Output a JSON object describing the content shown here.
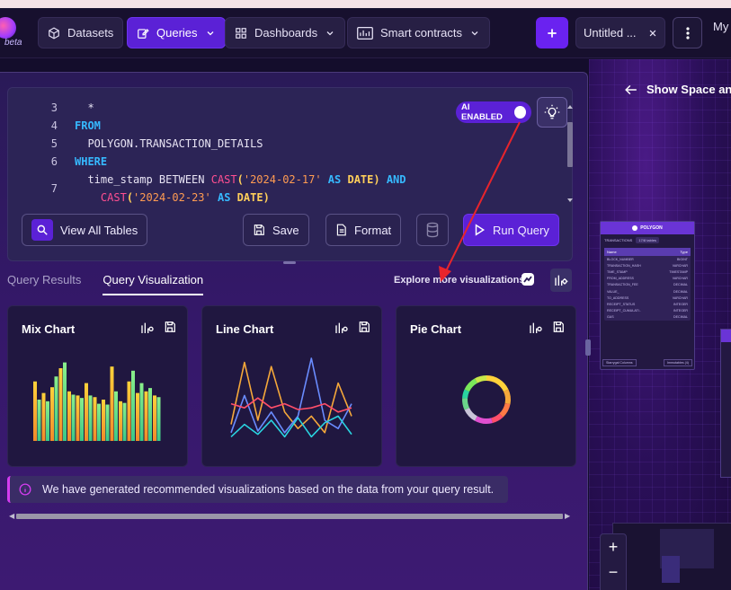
{
  "colors": {
    "accent": "#5b21d6",
    "panel": "#2c2456",
    "keyword": "#36b9ff",
    "function": "#ff4f91",
    "string": "#ff9b52",
    "type": "#ffcf5a",
    "arrow": "#e8242c"
  },
  "brand": {
    "logo_icon": "gradient-orb-icon",
    "badge": "beta"
  },
  "nav": {
    "datasets": "Datasets",
    "queries": "Queries",
    "dashboards": "Dashboards",
    "smart_contracts": "Smart contracts",
    "tab_title": "Untitled ...",
    "my_label": "My"
  },
  "editor": {
    "lines": [
      {
        "n": "3",
        "text": "  *"
      },
      {
        "n": "4",
        "text": "FROM"
      },
      {
        "n": "5",
        "text": "  POLYGON.TRANSACTION_DETAILS"
      },
      {
        "n": "6",
        "text": "WHERE"
      },
      {
        "n": "7",
        "text": "  time_stamp BETWEEN CAST('2024-02-17' AS DATE) AND"
      },
      {
        "n": "",
        "text": "    CAST('2024-02-23' AS DATE)"
      }
    ],
    "code": {
      "l3": "  *",
      "l4_kw": "FROM",
      "l5": "  POLYGON.TRANSACTION_DETAILS",
      "l6_kw": "WHERE",
      "l7_a": "  time_stamp BETWEEN ",
      "cast": "CAST",
      "paren_open": "(",
      "date1": "'2024-02-17'",
      "as": " AS ",
      "date_type": "DATE",
      "paren_close_and": ") ",
      "and": "AND",
      "l8_indent": "    ",
      "date2": "'2024-02-23'",
      "paren_close": ")"
    },
    "ai_label": "AI ENABLED",
    "buttons": {
      "view_all_tables": "View All Tables",
      "save": "Save",
      "format": "Format",
      "run_query": "Run Query"
    }
  },
  "results": {
    "tabs": [
      "Query Results",
      "Query Visualization"
    ],
    "active_tab": "Query Visualization",
    "explore": "Explore more visualizations",
    "cards": [
      {
        "title": "Mix Chart"
      },
      {
        "title": "Line Chart"
      },
      {
        "title": "Pie Chart"
      }
    ],
    "info": "We have generated recommended visualizations based on the data from your query result."
  },
  "canvas": {
    "back_label": "Show Space and",
    "node_title": "POLYGON",
    "node_tab": "TRANSACTIONS",
    "node_badge": "17/8 tables",
    "columns_header": [
      "Name",
      "Type"
    ],
    "columns": [
      [
        "BLOCK_NUMBER",
        "BIGINT"
      ],
      [
        "TRANSACTION_HASH",
        "VARCHAR"
      ],
      [
        "TIME_STAMP",
        "TIMESTAMP"
      ],
      [
        "FROM_ADDRESS",
        "VARCHAR"
      ],
      [
        "TRANSACTION_FEE",
        "DECIMAL"
      ],
      [
        "VALUE_",
        "DECIMAL"
      ],
      [
        "TO_ADDRESS",
        "VARCHAR"
      ],
      [
        "RECEIPT_STATUS",
        "INTEGER"
      ],
      [
        "RECEIPT_CUMULATI..",
        "INTEGER"
      ],
      [
        "GAS",
        "DECIMAL"
      ]
    ],
    "foot": [
      "Starrygal Columns",
      "Immutables (4)"
    ],
    "zoom_in": "+",
    "zoom_out": "−"
  },
  "chart_data": [
    {
      "type": "bar",
      "title": "Mix Chart",
      "series": [
        {
          "values": [
            0.72,
            0.58,
            0.65,
            0.88,
            0.6,
            0.55,
            0.7,
            0.53,
            0.5,
            0.9,
            0.48,
            0.72,
            0.58,
            0.6,
            0.55
          ]
        },
        {
          "values": [
            0.5,
            0.48,
            0.78,
            0.95,
            0.56,
            0.52,
            0.55,
            0.45,
            0.44,
            0.6,
            0.46,
            0.85,
            0.7,
            0.64,
            0.53
          ]
        }
      ]
    },
    {
      "type": "line",
      "title": "Line Chart",
      "series": [
        {
          "color": "#f5a83a",
          "values": [
            0.2,
            0.95,
            0.25,
            0.9,
            0.35,
            0.15,
            0.3,
            0.1,
            0.7,
            0.3
          ]
        },
        {
          "color": "#6a8cff",
          "values": [
            0.1,
            0.55,
            0.12,
            0.35,
            0.1,
            0.3,
            1.0,
            0.25,
            0.15,
            0.45
          ]
        },
        {
          "color": "#ff4f6a",
          "values": [
            0.45,
            0.4,
            0.52,
            0.4,
            0.45,
            0.38,
            0.4,
            0.45,
            0.35,
            0.4
          ]
        },
        {
          "color": "#2ad4e0",
          "values": [
            0.05,
            0.2,
            0.08,
            0.25,
            0.05,
            0.28,
            0.05,
            0.22,
            0.3,
            0.08
          ]
        }
      ]
    },
    {
      "type": "pie",
      "title": "Pie Chart",
      "values": [
        18,
        10,
        10,
        8,
        12,
        10,
        8,
        6,
        10,
        8
      ],
      "colors": [
        "#ffd23a",
        "#f5a83a",
        "#ff7a45",
        "#ff4f6a",
        "#e04fd0",
        "#c8c4d8",
        "#6ad48a",
        "#2ad4a0",
        "#7ae85a",
        "#c8e84a"
      ]
    }
  ]
}
